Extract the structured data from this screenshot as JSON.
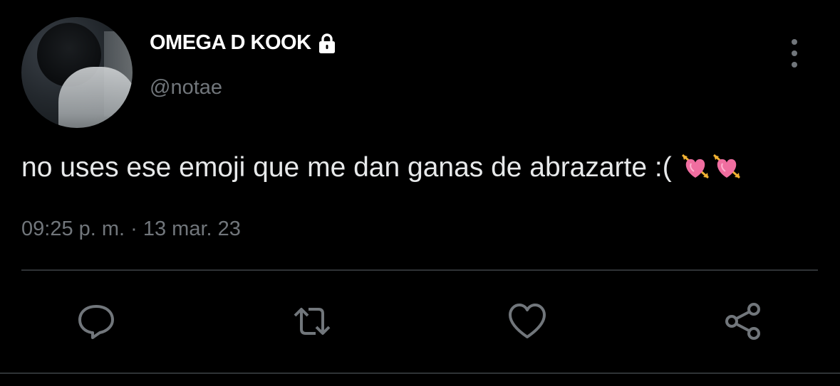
{
  "tweet": {
    "author": {
      "display_name": "OMEGA D KOOK",
      "handle": "@notae",
      "protected": true
    },
    "text": "no uses ese emoji que me dan ganas de abrazarte :(",
    "emojis": [
      "heart-with-arrow",
      "heart-with-arrow"
    ],
    "timestamp": "09:25 p. m. · 13 mar. 23"
  },
  "actions": [
    {
      "name": "reply",
      "icon": "speech-bubble-icon"
    },
    {
      "name": "retweet",
      "icon": "retweet-icon"
    },
    {
      "name": "like",
      "icon": "heart-outline-icon"
    },
    {
      "name": "share",
      "icon": "share-icon"
    }
  ],
  "colors": {
    "background": "#000000",
    "primary_text": "#e7e9ea",
    "secondary_text": "#71767b",
    "divider": "#2f3336",
    "emoji_heart": "#f06ea0",
    "emoji_arrow": "#f2b233"
  }
}
